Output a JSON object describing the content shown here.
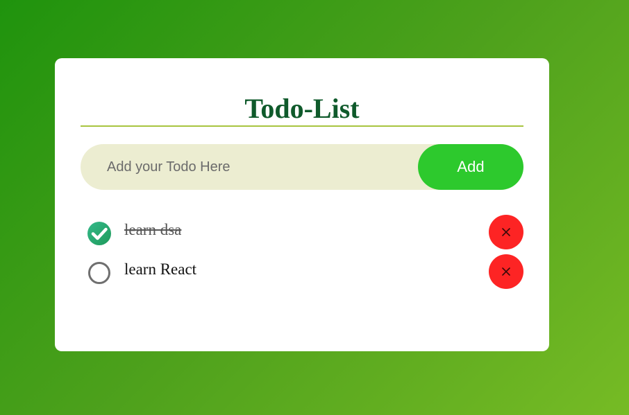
{
  "app": {
    "title": "Todo-List"
  },
  "input": {
    "value": "",
    "placeholder": "Add your Todo Here",
    "add_label": "Add"
  },
  "todos": [
    {
      "text": "learn dsa",
      "completed": true,
      "delete_icon": "close-icon"
    },
    {
      "text": "learn React",
      "completed": false,
      "delete_icon": "close-icon"
    }
  ],
  "colors": {
    "accent_green": "#2dc92d",
    "title_green": "#0f5a2b",
    "delete_red": "#fd2424",
    "input_bg": "#ecedd1",
    "divider": "#a8c43f"
  }
}
